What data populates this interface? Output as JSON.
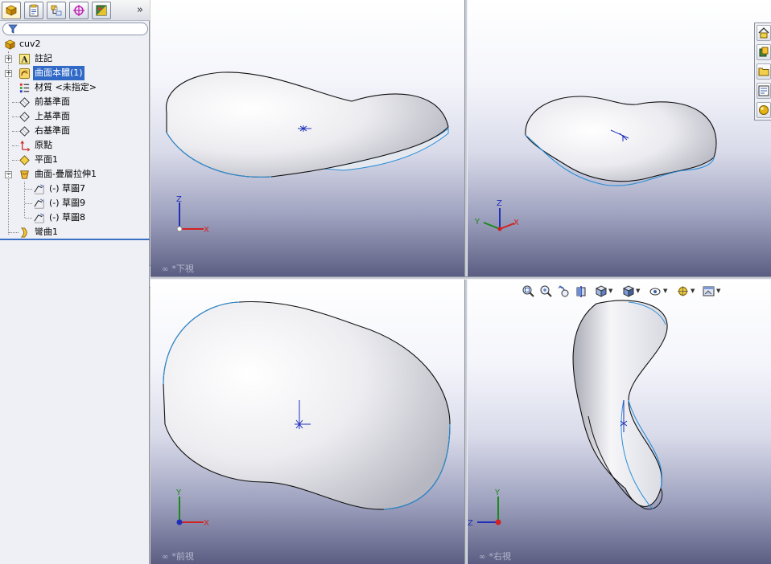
{
  "feature_tree": {
    "tabs": [
      {
        "name": "feature-manager",
        "icon": "feature-manager-icon"
      },
      {
        "name": "property-manager",
        "icon": "property-manager-icon"
      },
      {
        "name": "configuration-manager",
        "icon": "configuration-manager-icon"
      },
      {
        "name": "dimxpert-manager",
        "icon": "dimxpert-icon"
      },
      {
        "name": "display-manager",
        "icon": "display-manager-icon"
      }
    ],
    "more_tabs_glyph": "»",
    "root": "cuv2",
    "items": [
      {
        "label": "註記",
        "icon": "annotations-icon",
        "expander": "+"
      },
      {
        "label": "曲面本體(1)",
        "icon": "surface-bodies-icon",
        "expander": "+",
        "selected": true
      },
      {
        "label": "材質 <未指定>",
        "icon": "material-icon"
      },
      {
        "label": "前基準面",
        "icon": "plane-icon"
      },
      {
        "label": "上基準面",
        "icon": "plane-icon"
      },
      {
        "label": "右基準面",
        "icon": "plane-icon"
      },
      {
        "label": "原點",
        "icon": "origin-icon"
      },
      {
        "label": "平面1",
        "icon": "plane-feature-icon"
      },
      {
        "label": "曲面-疊層拉伸1",
        "icon": "surface-loft-icon",
        "expander": "−"
      },
      {
        "label": "(-) 草圖7",
        "icon": "sketch-icon"
      },
      {
        "label": "(-) 草圖9",
        "icon": "sketch-icon"
      },
      {
        "label": "(-) 草圖8",
        "icon": "sketch-icon"
      },
      {
        "label": "彎曲1",
        "icon": "flex-icon"
      }
    ]
  },
  "viewports": [
    {
      "id": "top-left",
      "label": "*下視",
      "axes": [
        "Z",
        "X"
      ]
    },
    {
      "id": "top-right",
      "label": "",
      "axes": [
        "Z",
        "Y",
        "X"
      ]
    },
    {
      "id": "bottom-left",
      "label": "*前視",
      "axes": [
        "Y",
        "X"
      ]
    },
    {
      "id": "bottom-right",
      "label": "*右視",
      "axes": [
        "Y",
        "Z"
      ]
    }
  ],
  "hud_toolbar": [
    {
      "name": "zoom-to-fit",
      "icon": "zoom-to-fit-icon"
    },
    {
      "name": "zoom-to-area",
      "icon": "zoom-to-area-icon"
    },
    {
      "name": "previous-view",
      "icon": "previous-view-icon"
    },
    {
      "name": "section-view",
      "icon": "section-view-icon"
    },
    {
      "name": "view-orientation",
      "icon": "view-orientation-icon",
      "dropdown": true
    },
    {
      "name": "display-style",
      "icon": "display-style-icon",
      "dropdown": true
    },
    {
      "name": "hide-show-items",
      "icon": "hide-show-icon",
      "dropdown": true
    },
    {
      "name": "edit-appearance",
      "icon": "appearance-icon",
      "dropdown": true
    },
    {
      "name": "apply-scene",
      "icon": "scene-icon",
      "dropdown": true
    }
  ],
  "task_pane": [
    {
      "name": "solidworks-resources",
      "icon": "home-icon"
    },
    {
      "name": "design-library",
      "icon": "design-library-icon"
    },
    {
      "name": "file-explorer",
      "icon": "folder-icon"
    },
    {
      "name": "view-palette",
      "icon": "view-palette-icon"
    },
    {
      "name": "appearances-scenes",
      "icon": "appearance-sphere-icon"
    }
  ],
  "colors": {
    "selection": "#3169c6",
    "axis_x": "#d22222",
    "axis_y": "#1a8a1a",
    "axis_z": "#1f2fb8",
    "edge_highlight": "#2b8fd8"
  }
}
